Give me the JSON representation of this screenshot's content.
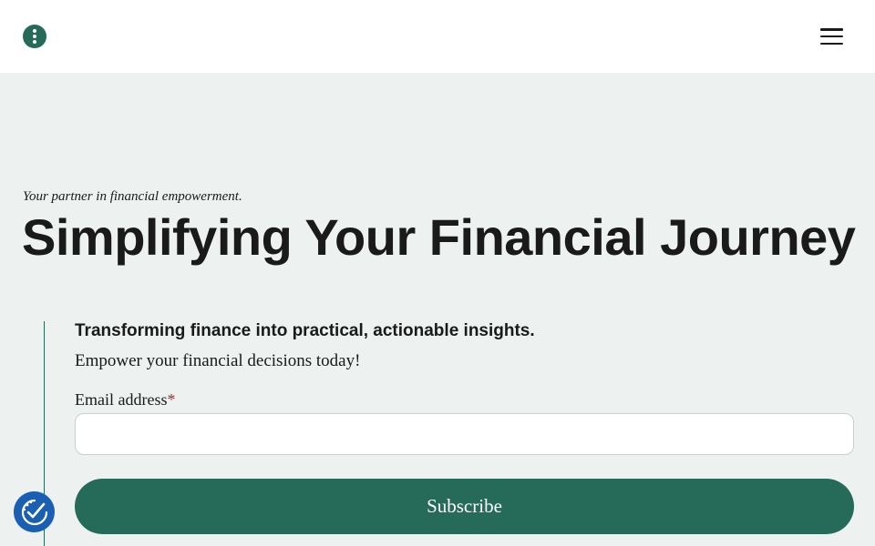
{
  "header": {
    "menu_icon": "vertical-dots-icon",
    "nav_icon": "hamburger-icon"
  },
  "hero": {
    "tagline": "Your partner in financial empowerment.",
    "title": "Simplifying Your Financial Journey"
  },
  "form": {
    "heading": "Transforming finance into practical, actionable insights.",
    "subheading": "Empower your financial decisions today!",
    "email_label": "Email address",
    "required_mark": "*",
    "email_value": "",
    "email_placeholder": "",
    "submit_label": "Subscribe"
  },
  "accessibility": {
    "icon": "accessibility-check-icon"
  },
  "colors": {
    "accent": "#266b5a",
    "page_background": "#edf1f0",
    "header_background": "#ffffff",
    "required": "#b4262b",
    "accessibility_button": "#1a5fb4"
  }
}
